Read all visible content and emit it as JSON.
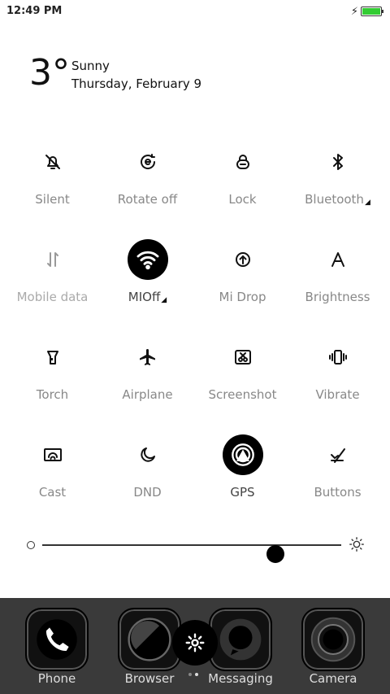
{
  "status_bar": {
    "time": "12:49 PM",
    "battery_level": 1.0,
    "battery_color": "#33cc33",
    "charging_icon": "bolt-icon"
  },
  "weather": {
    "temperature": "3°",
    "condition": "Sunny",
    "date": "Thursday, February 9"
  },
  "toggles": [
    {
      "label": "Silent",
      "icon": "bell-off-icon",
      "active": false
    },
    {
      "label": "Rotate off",
      "icon": "rotate-lock-icon",
      "active": false
    },
    {
      "label": "Lock",
      "icon": "lock-icon",
      "active": false
    },
    {
      "label": "Bluetooth",
      "icon": "bluetooth-icon",
      "active": false
    },
    {
      "label": "Mobile data",
      "icon": "mobile-data-icon",
      "active": false
    },
    {
      "label": "MIOff",
      "icon": "wifi-icon",
      "active": true
    },
    {
      "label": "Mi Drop",
      "icon": "mi-drop-icon",
      "active": false
    },
    {
      "label": "Brightness",
      "icon": "auto-brightness-icon",
      "active": false
    },
    {
      "label": "Torch",
      "icon": "torch-icon",
      "active": false
    },
    {
      "label": "Airplane",
      "icon": "airplane-icon",
      "active": false
    },
    {
      "label": "Screenshot",
      "icon": "screenshot-icon",
      "active": false
    },
    {
      "label": "Vibrate",
      "icon": "vibrate-icon",
      "active": false
    },
    {
      "label": "Cast",
      "icon": "cast-icon",
      "active": false
    },
    {
      "label": "DND",
      "icon": "moon-icon",
      "active": false
    },
    {
      "label": "GPS",
      "icon": "gps-icon",
      "active": true
    },
    {
      "label": "Buttons",
      "icon": "buttons-off-icon",
      "active": false
    }
  ],
  "brightness": {
    "level": 0.78
  },
  "dock": {
    "apps": [
      {
        "label": "Phone",
        "icon": "phone-icon"
      },
      {
        "label": "Browser",
        "icon": "browser-icon"
      },
      {
        "label": "Messaging",
        "icon": "messaging-icon"
      },
      {
        "label": "Camera",
        "icon": "camera-icon"
      }
    ],
    "settings_icon": "gear-icon",
    "page_count": 2,
    "active_page": 1
  }
}
